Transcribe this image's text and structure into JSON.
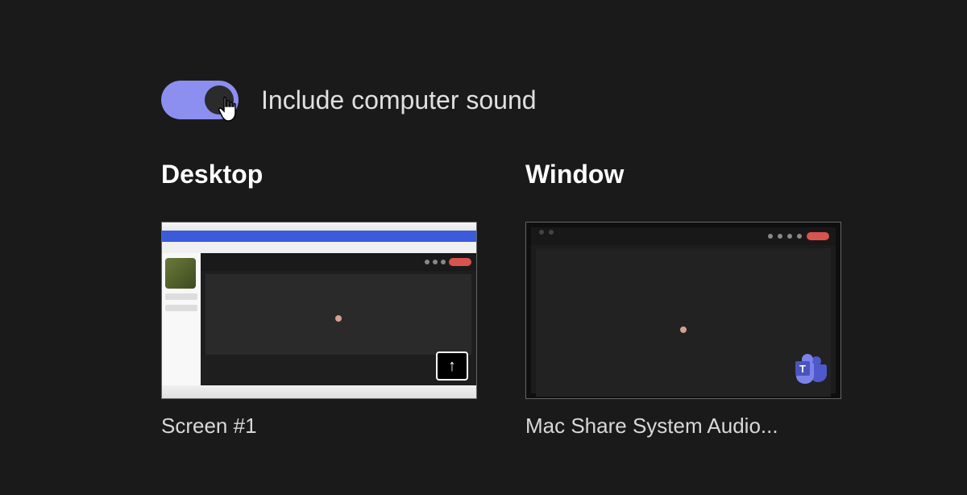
{
  "toggle": {
    "label": "Include computer sound",
    "state": "on",
    "colors": {
      "track": "#8c8ef0",
      "knob": "#2b2b2b"
    }
  },
  "sections": {
    "desktop": {
      "title": "Desktop",
      "items": [
        {
          "label": "Screen #1"
        }
      ]
    },
    "window": {
      "title": "Window",
      "items": [
        {
          "label": "Mac Share System Audio...",
          "app": "Microsoft Teams"
        }
      ]
    }
  },
  "icons": {
    "share_up": "↑",
    "cursor": "hand-pointer",
    "teams": "teams-icon"
  }
}
